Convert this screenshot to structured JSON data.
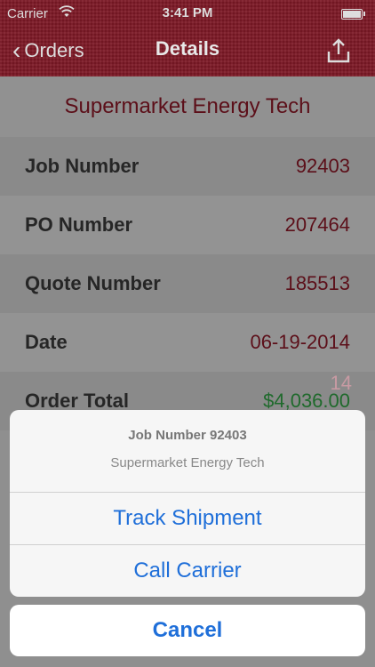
{
  "status_bar": {
    "carrier": "Carrier",
    "time": "3:41 PM"
  },
  "nav": {
    "back_label": "Orders",
    "title": "Details",
    "share_icon": "share-icon"
  },
  "company_name": "Supermarket Energy Tech",
  "rows": [
    {
      "key": "Job Number",
      "value": "92403"
    },
    {
      "key": "PO Number",
      "value": "207464"
    },
    {
      "key": "Quote Number",
      "value": "185513"
    },
    {
      "key": "Date",
      "value": "06-19-2014"
    },
    {
      "key": "Order Total",
      "value": "$4,036.00"
    }
  ],
  "obscured_value": "14",
  "action_sheet": {
    "title": "Job Number 92403",
    "subtitle": "Supermarket Energy Tech",
    "actions": [
      "Track Shipment",
      "Call Carrier"
    ],
    "cancel_label": "Cancel"
  },
  "colors": {
    "nav_bg": "#7d1825",
    "accent_text": "#5c0f19",
    "money": "#1f6a2c",
    "action_blue": "#1f6fd9"
  }
}
